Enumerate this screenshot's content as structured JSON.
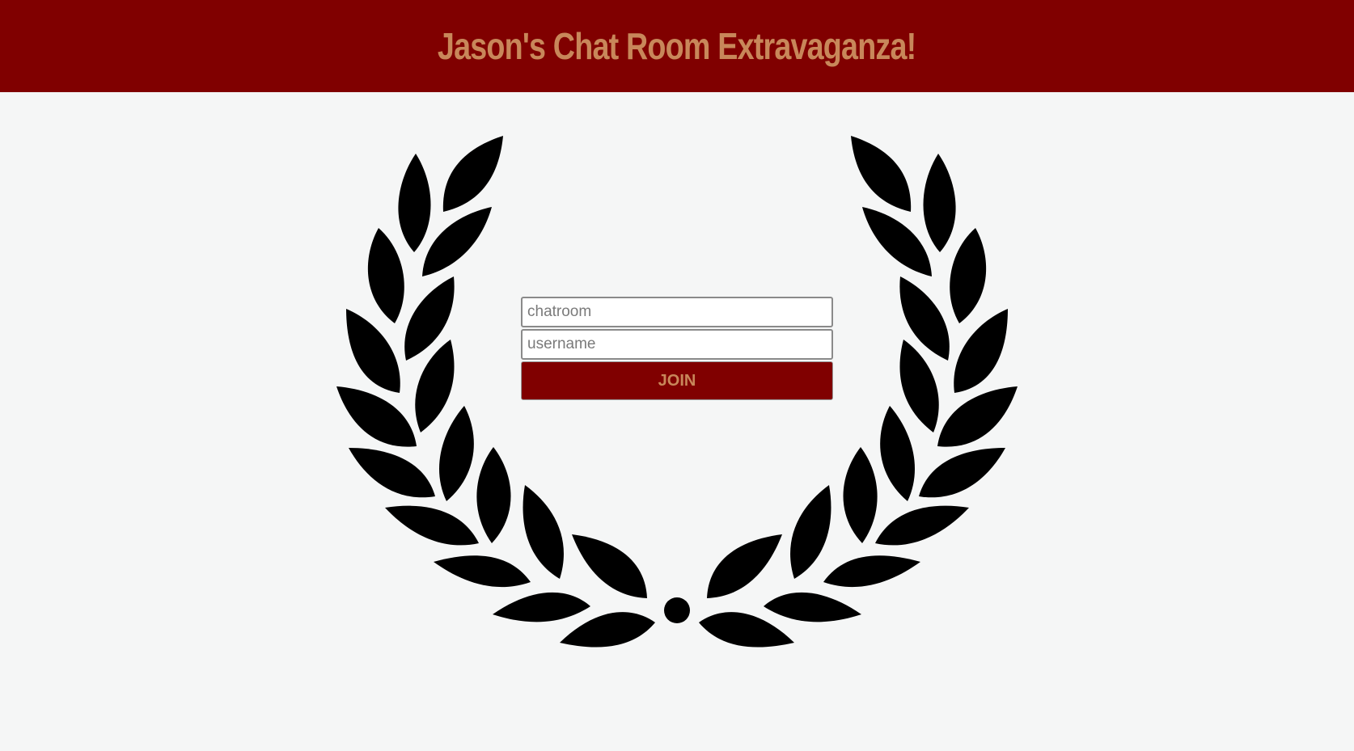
{
  "header": {
    "title": "Jason's Chat Room Extravaganza!"
  },
  "decoration": {
    "wreath_icon": "laurel-wreath-icon",
    "wreath_color": "#000000"
  },
  "form": {
    "chatroom": {
      "value": "",
      "placeholder": "chatroom"
    },
    "username": {
      "value": "",
      "placeholder": "username"
    },
    "join_label": "JOIN"
  },
  "colors": {
    "header_background": "#800000",
    "accent_text": "#c8875a",
    "page_background": "#f5f6f6"
  }
}
